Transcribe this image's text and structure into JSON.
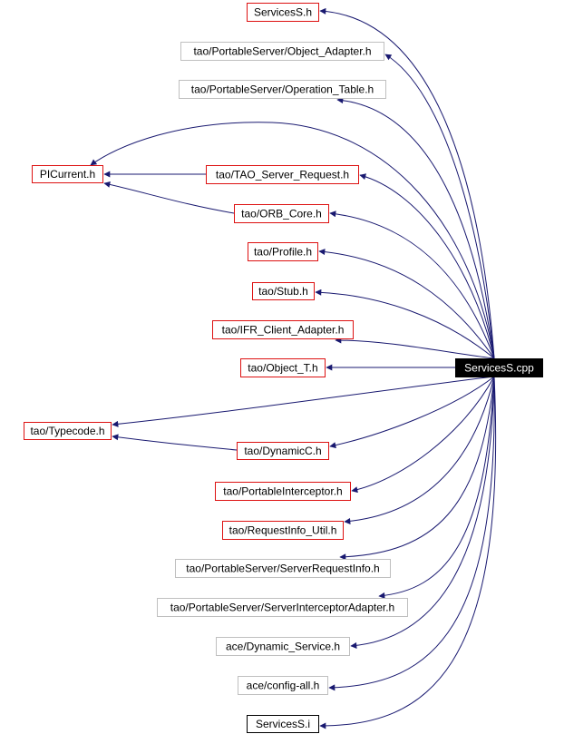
{
  "diagram": {
    "type": "include-dependency-graph",
    "colors": {
      "edge": "#191970",
      "border_red": "#dd1111",
      "border_gray": "#bfbfbf",
      "border_black": "#000000",
      "root_fill": "#000000",
      "root_text": "#ffffff",
      "text": "#000000"
    },
    "root": {
      "id": "root",
      "label": "ServicesS.cpp"
    },
    "nodes": [
      {
        "id": "servicess_h",
        "label": "ServicesS.h",
        "style": "red"
      },
      {
        "id": "object_adapter",
        "label": "tao/PortableServer/Object_Adapter.h",
        "style": "gray"
      },
      {
        "id": "operation_table",
        "label": "tao/PortableServer/Operation_Table.h",
        "style": "gray"
      },
      {
        "id": "picurrent",
        "label": "PICurrent.h",
        "style": "red"
      },
      {
        "id": "tao_server_request",
        "label": "tao/TAO_Server_Request.h",
        "style": "red"
      },
      {
        "id": "orb_core",
        "label": "tao/ORB_Core.h",
        "style": "red"
      },
      {
        "id": "profile",
        "label": "tao/Profile.h",
        "style": "red"
      },
      {
        "id": "stub",
        "label": "tao/Stub.h",
        "style": "red"
      },
      {
        "id": "ifr_client_adapter",
        "label": "tao/IFR_Client_Adapter.h",
        "style": "red"
      },
      {
        "id": "object_t",
        "label": "tao/Object_T.h",
        "style": "red"
      },
      {
        "id": "typecode",
        "label": "tao/Typecode.h",
        "style": "red"
      },
      {
        "id": "dynamicc",
        "label": "tao/DynamicC.h",
        "style": "red"
      },
      {
        "id": "portable_interceptor",
        "label": "tao/PortableInterceptor.h",
        "style": "red"
      },
      {
        "id": "requestinfo_util",
        "label": "tao/RequestInfo_Util.h",
        "style": "red"
      },
      {
        "id": "server_request_info",
        "label": "tao/PortableServer/ServerRequestInfo.h",
        "style": "gray"
      },
      {
        "id": "server_interceptor_adapter",
        "label": "tao/PortableServer/ServerInterceptorAdapter.h",
        "style": "gray"
      },
      {
        "id": "dynamic_service",
        "label": "ace/Dynamic_Service.h",
        "style": "gray"
      },
      {
        "id": "config_all",
        "label": "ace/config-all.h",
        "style": "gray"
      },
      {
        "id": "servicess_i",
        "label": "ServicesS.i",
        "style": "black"
      }
    ],
    "edges": [
      {
        "from": "root",
        "to": "servicess_h"
      },
      {
        "from": "root",
        "to": "object_adapter"
      },
      {
        "from": "root",
        "to": "operation_table"
      },
      {
        "from": "root",
        "to": "picurrent"
      },
      {
        "from": "root",
        "to": "tao_server_request"
      },
      {
        "from": "root",
        "to": "orb_core"
      },
      {
        "from": "root",
        "to": "profile"
      },
      {
        "from": "root",
        "to": "stub"
      },
      {
        "from": "root",
        "to": "ifr_client_adapter"
      },
      {
        "from": "root",
        "to": "object_t"
      },
      {
        "from": "root",
        "to": "typecode"
      },
      {
        "from": "root",
        "to": "dynamicc"
      },
      {
        "from": "root",
        "to": "portable_interceptor"
      },
      {
        "from": "root",
        "to": "requestinfo_util"
      },
      {
        "from": "root",
        "to": "server_request_info"
      },
      {
        "from": "root",
        "to": "server_interceptor_adapter"
      },
      {
        "from": "root",
        "to": "dynamic_service"
      },
      {
        "from": "root",
        "to": "config_all"
      },
      {
        "from": "root",
        "to": "servicess_i"
      },
      {
        "from": "tao_server_request",
        "to": "picurrent"
      },
      {
        "from": "orb_core",
        "to": "picurrent"
      },
      {
        "from": "dynamicc",
        "to": "typecode"
      }
    ]
  }
}
